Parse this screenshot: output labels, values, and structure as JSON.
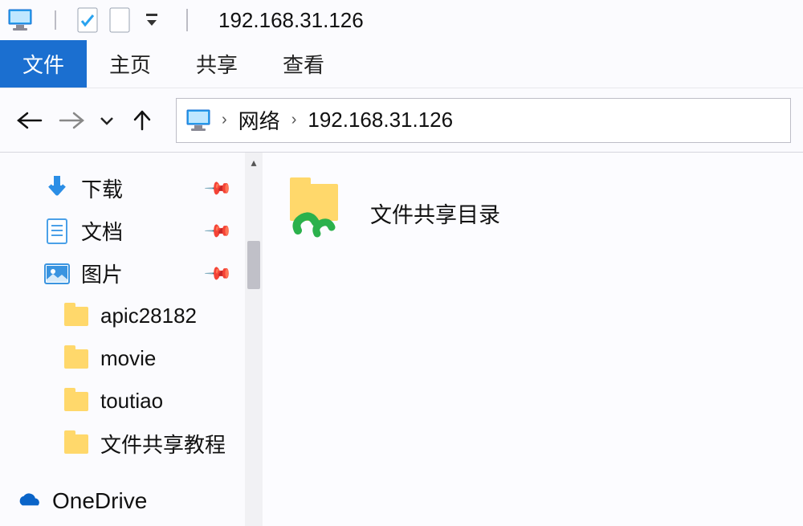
{
  "title": "192.168.31.126",
  "ribbon": {
    "file": "文件",
    "home": "主页",
    "share": "共享",
    "view": "查看"
  },
  "breadcrumb": {
    "network": "网络",
    "address": "192.168.31.126"
  },
  "sidebar": {
    "downloads": "下载",
    "documents": "文档",
    "pictures": "图片",
    "folders": [
      "apic28182",
      "movie",
      "toutiao",
      "文件共享教程"
    ],
    "onedrive": "OneDrive"
  },
  "content": {
    "share_folder": "文件共享目录"
  }
}
